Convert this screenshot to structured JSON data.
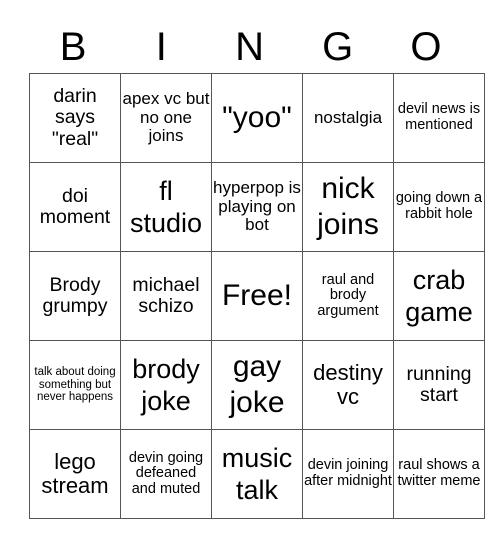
{
  "header": {
    "letters": [
      "B",
      "I",
      "N",
      "G",
      "O"
    ]
  },
  "grid": {
    "rows": [
      [
        "darin says \"real\"",
        "apex vc but no one joins",
        "\"yoo\"",
        "nostalgia",
        "devil news is mentioned"
      ],
      [
        "doi moment",
        "fl studio",
        "hyperpop is playing on bot",
        "nick joins",
        "going down a rabbit hole"
      ],
      [
        "Brody grumpy",
        "michael schizo",
        "Free!",
        "raul and brody argument",
        "crab game"
      ],
      [
        "talk about doing something but never happens",
        "brody joke",
        "gay joke",
        "destiny vc",
        "running start"
      ],
      [
        "lego stream",
        "devin going defeaned and muted",
        "music talk",
        "devin joining after midnight",
        "raul shows a twitter meme"
      ]
    ]
  }
}
